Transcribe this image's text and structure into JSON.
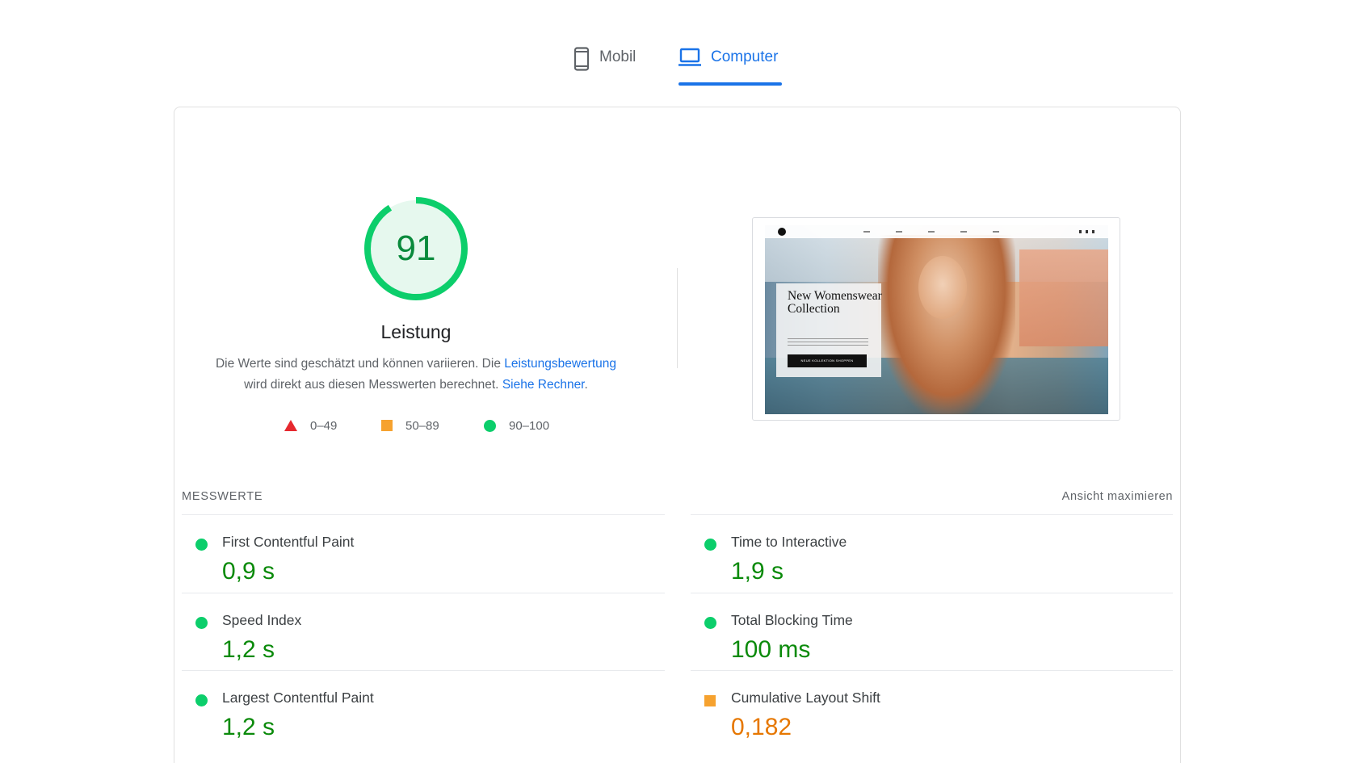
{
  "tabs": [
    {
      "label": "Mobil",
      "icon": "smartphone-icon",
      "selected": false
    },
    {
      "label": "Computer",
      "icon": "laptop-icon",
      "selected": true
    }
  ],
  "colors": {
    "accent": "#1a73e8",
    "pass": "#0cce6b",
    "pass_text": "#0a8a0a",
    "average": "#f6a22f",
    "average_text": "#e67700",
    "fail": "#e6282e"
  },
  "performance": {
    "score": "91",
    "score_fraction": 0.91,
    "title": "Leistung",
    "description_part1": "Die Werte sind geschätzt und können variieren. Die ",
    "description_link1": "Leistungsbewertung",
    "description_part2": "wird direkt aus diesen Messwerten berechnet. ",
    "description_link2": "Siehe Rechner",
    "description_end": ".",
    "legend": [
      {
        "range": "0–49",
        "icon": "triangle-icon",
        "rating": "fail"
      },
      {
        "range": "50–89",
        "icon": "square-icon",
        "rating": "average"
      },
      {
        "range": "90–100",
        "icon": "circle-icon",
        "rating": "pass"
      }
    ]
  },
  "screenshot": {
    "headline": "New Womenswear Collection",
    "button_label": "NEUE KOLLEKTION SHOPPEN"
  },
  "metrics": {
    "title": "MESSWERTE",
    "toggle_label": "Ansicht maximieren",
    "items": [
      {
        "name": "First Contentful Paint",
        "value": "0,9 s",
        "rating": "pass"
      },
      {
        "name": "Time to Interactive",
        "value": "1,9 s",
        "rating": "pass"
      },
      {
        "name": "Speed Index",
        "value": "1,2 s",
        "rating": "pass"
      },
      {
        "name": "Total Blocking Time",
        "value": "100 ms",
        "rating": "pass"
      },
      {
        "name": "Largest Contentful Paint",
        "value": "1,2 s",
        "rating": "pass"
      },
      {
        "name": "Cumulative Layout Shift",
        "value": "0,182",
        "rating": "average"
      }
    ]
  }
}
